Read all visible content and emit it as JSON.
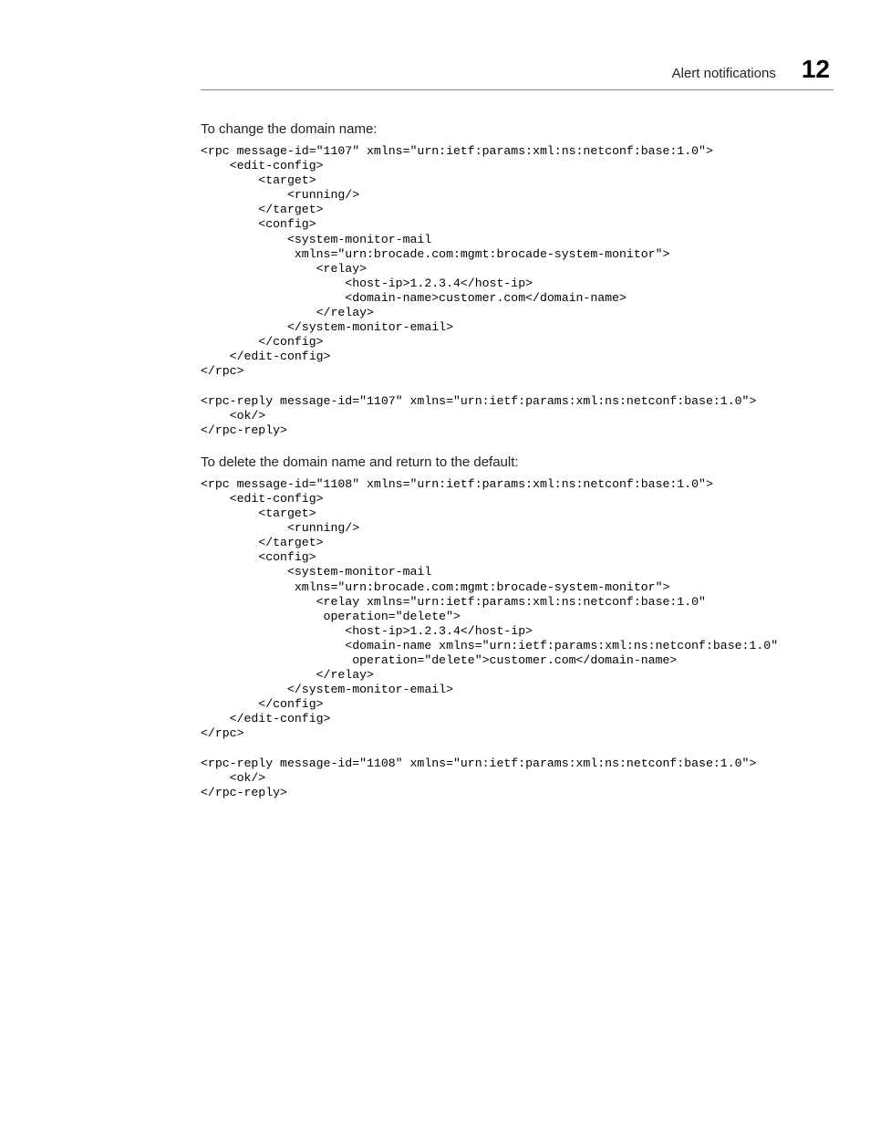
{
  "header": {
    "title": "Alert notifications",
    "chapter_number": "12"
  },
  "section1": {
    "para": "To change the domain name:",
    "code": "<rpc message-id=\"1107\" xmlns=\"urn:ietf:params:xml:ns:netconf:base:1.0\">\n    <edit-config>\n        <target>\n            <running/>\n        </target>\n        <config>\n            <system-monitor-mail\n             xmlns=\"urn:brocade.com:mgmt:brocade-system-monitor\">\n                <relay>\n                    <host-ip>1.2.3.4</host-ip>\n                    <domain-name>customer.com</domain-name>\n                </relay>\n            </system-monitor-email>\n        </config>\n    </edit-config>\n</rpc>\n\n<rpc-reply message-id=\"1107\" xmlns=\"urn:ietf:params:xml:ns:netconf:base:1.0\">\n    <ok/>\n</rpc-reply>"
  },
  "section2": {
    "para": "To delete the domain name and return to the default:",
    "code": "<rpc message-id=\"1108\" xmlns=\"urn:ietf:params:xml:ns:netconf:base:1.0\">\n    <edit-config>\n        <target>\n            <running/>\n        </target>\n        <config>\n            <system-monitor-mail\n             xmlns=\"urn:brocade.com:mgmt:brocade-system-monitor\">\n                <relay xmlns=\"urn:ietf:params:xml:ns:netconf:base:1.0\"\n                 operation=\"delete\">\n                    <host-ip>1.2.3.4</host-ip>\n                    <domain-name xmlns=\"urn:ietf:params:xml:ns:netconf:base:1.0\"\n                     operation=\"delete\">customer.com</domain-name>\n                </relay>\n            </system-monitor-email>\n        </config>\n    </edit-config>\n</rpc>\n\n<rpc-reply message-id=\"1108\" xmlns=\"urn:ietf:params:xml:ns:netconf:base:1.0\">\n    <ok/>\n</rpc-reply>"
  }
}
